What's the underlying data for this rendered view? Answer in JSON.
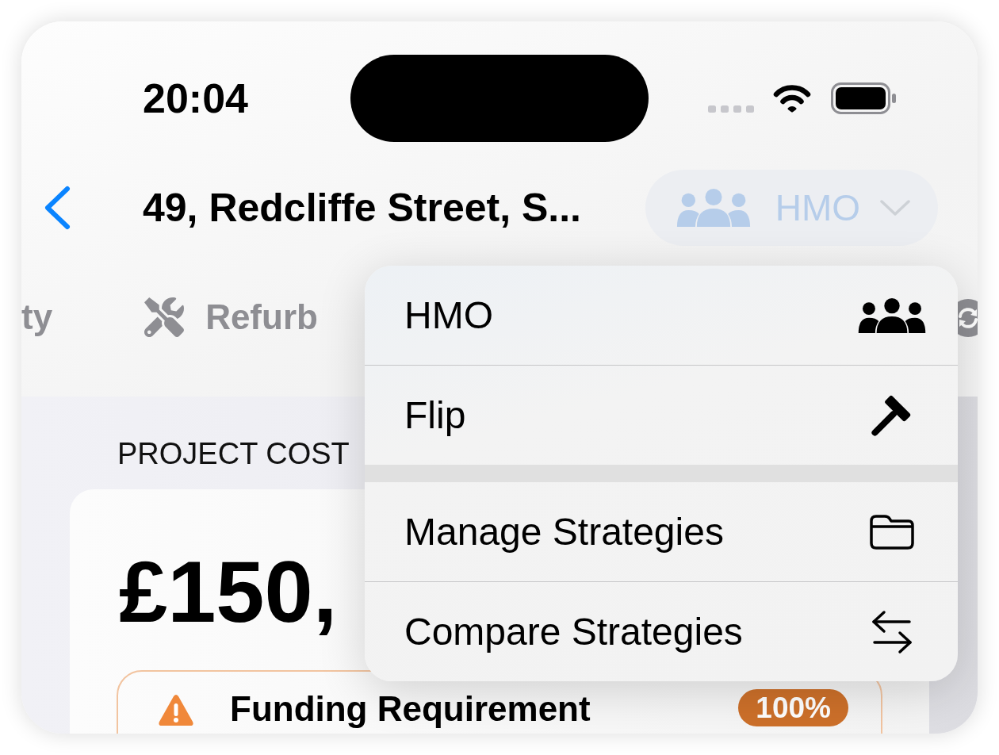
{
  "status_bar": {
    "time": "20:04"
  },
  "nav_bar": {
    "title": "49, Redcliffe Street, S...",
    "strategy_picker": {
      "label": "HMO",
      "expanded": true
    }
  },
  "tabs": [
    {
      "label": "ty",
      "selected": false
    },
    {
      "label": "Refurb",
      "selected": false
    }
  ],
  "section": {
    "heading": "PROJECT COST",
    "card": {
      "amount": "£150,",
      "alert": {
        "title": "Funding Requirement",
        "badge": "100%"
      }
    }
  },
  "menu": {
    "groups": [
      [
        {
          "label": "HMO"
        },
        {
          "label": "Flip"
        }
      ],
      [
        {
          "label": "Manage Strategies"
        },
        {
          "label": "Compare Strategies"
        }
      ]
    ]
  }
}
